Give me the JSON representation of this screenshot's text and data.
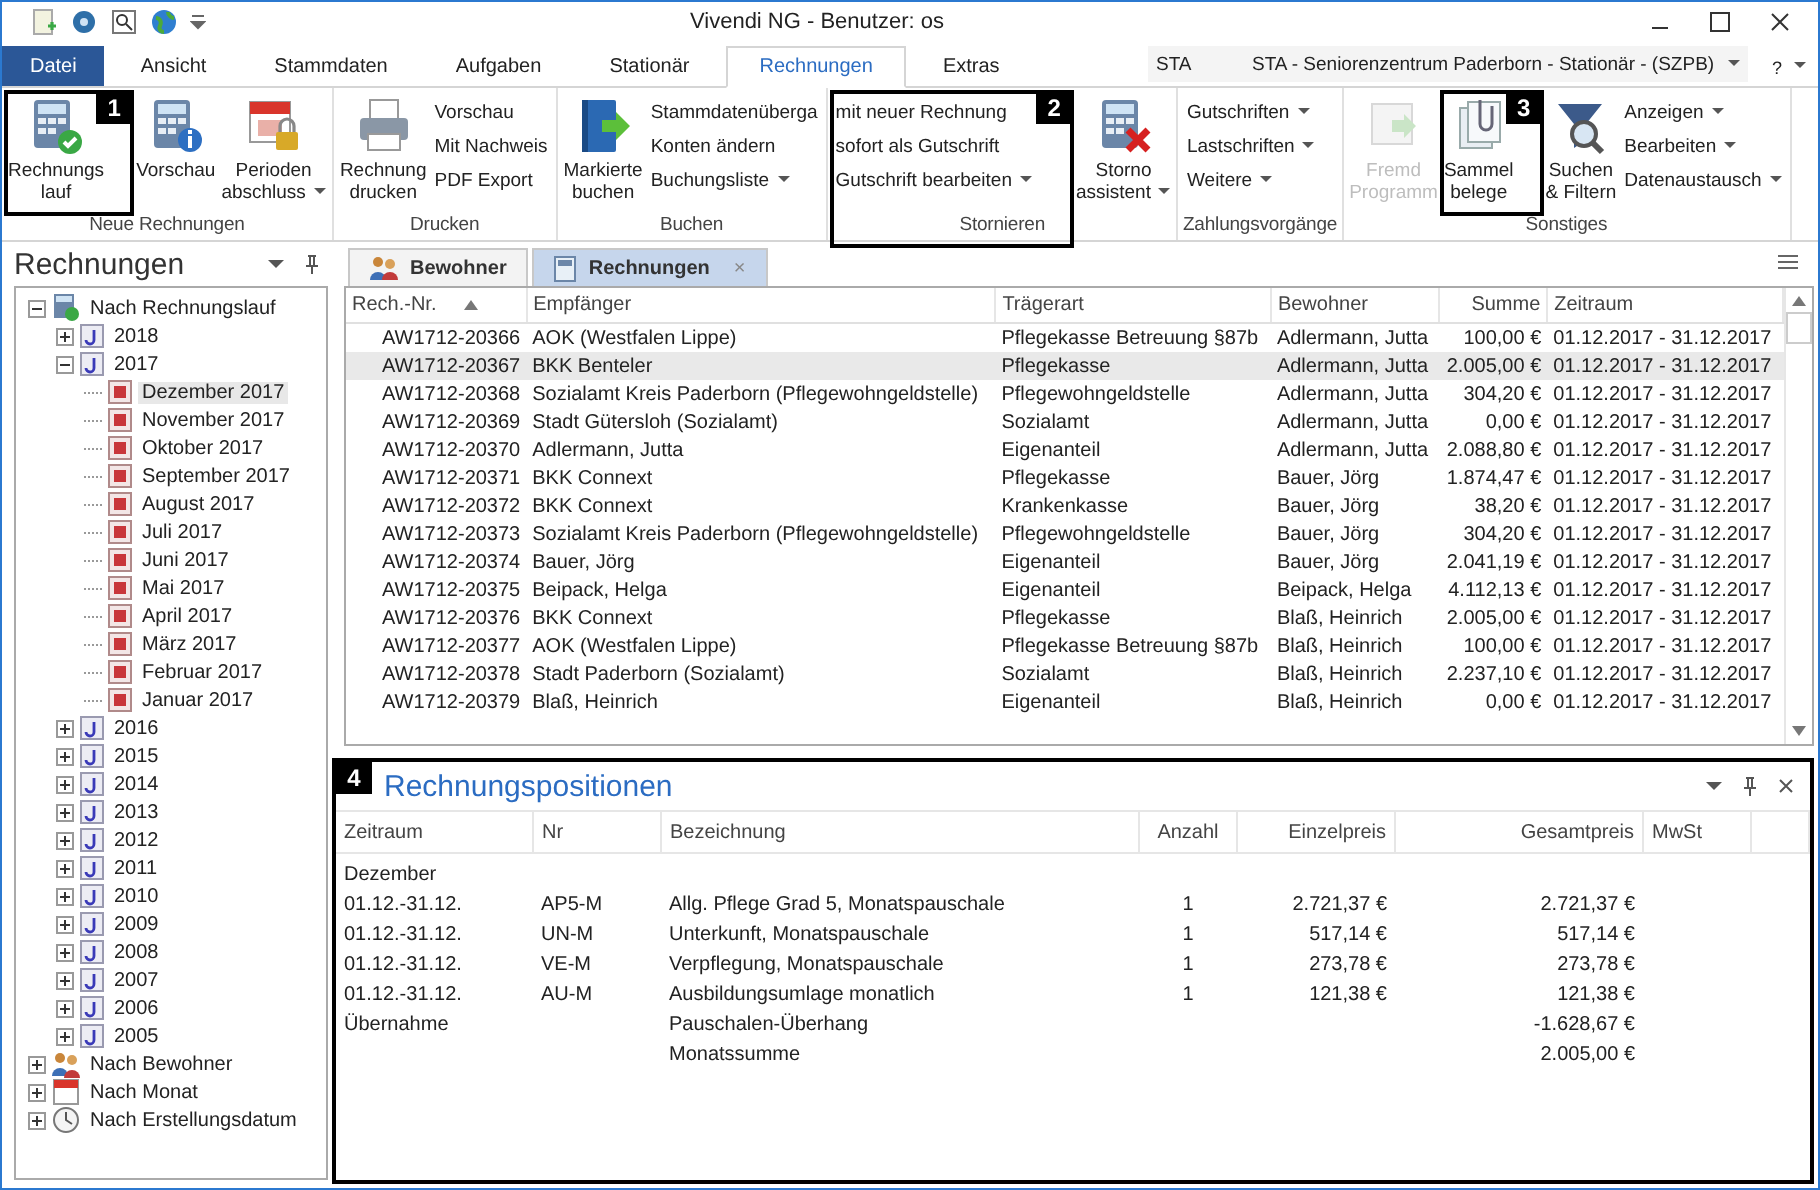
{
  "window": {
    "title": "Vivendi NG - Benutzer: os"
  },
  "ribbon_tabs": [
    {
      "label": "Datei",
      "kind": "app"
    },
    {
      "label": "Ansicht",
      "kind": "tab",
      "selected": false
    },
    {
      "label": "Stammdaten",
      "kind": "tab",
      "selected": false
    },
    {
      "label": "Aufgaben",
      "kind": "tab",
      "selected": false
    },
    {
      "label": "Stationär",
      "kind": "tab",
      "selected": false
    },
    {
      "label": "Rechnungen",
      "kind": "tab",
      "selected": true
    },
    {
      "label": "Extras",
      "kind": "tab",
      "selected": false
    }
  ],
  "station": {
    "code": "STA",
    "name": "STA - Seniorenzentrum Paderborn - Stationär - (SZPB)"
  },
  "help": "?",
  "ribbon_groups": [
    {
      "label": "Neue Rechnungen",
      "items": [
        {
          "kind": "large",
          "lines": [
            "Rechnungs",
            "lauf"
          ],
          "callout": "1"
        },
        {
          "kind": "large",
          "lines": [
            "Vorschau"
          ]
        },
        {
          "kind": "large",
          "lines": [
            "Perioden",
            "abschluss"
          ],
          "dropdown": true
        }
      ]
    },
    {
      "label": "Drucken",
      "items": [
        {
          "kind": "large",
          "lines": [
            "Rechnung",
            "drucken"
          ]
        },
        {
          "kind": "stack",
          "entries": [
            {
              "label": "Vorschau"
            },
            {
              "label": "Mit Nachweis"
            },
            {
              "label": "PDF Export"
            }
          ]
        }
      ]
    },
    {
      "label": "Buchen",
      "items": [
        {
          "kind": "large",
          "lines": [
            "Markierte",
            "buchen"
          ]
        },
        {
          "kind": "stack",
          "entries": [
            {
              "label": "Stammdatenüberga"
            },
            {
              "label": "Konten ändern"
            },
            {
              "label": "Buchungsliste",
              "dropdown": true
            }
          ]
        }
      ]
    },
    {
      "label": "Stornieren",
      "items": [
        {
          "kind": "stack",
          "callout": "2",
          "entries": [
            {
              "label": "mit neuer Rechnung"
            },
            {
              "label": "sofort als Gutschrift"
            },
            {
              "label": "Gutschrift bearbeiten",
              "dropdown": true
            }
          ]
        },
        {
          "kind": "large",
          "lines": [
            "Storno",
            "assistent"
          ],
          "dropdown": true
        }
      ]
    },
    {
      "label": "Zahlungsvorgänge",
      "items": [
        {
          "kind": "stack",
          "entries": [
            {
              "label": "Gutschriften",
              "dropdown": true
            },
            {
              "label": "Lastschriften",
              "dropdown": true
            },
            {
              "label": "Weitere",
              "dropdown": true
            }
          ]
        }
      ]
    },
    {
      "label": "Sonstiges",
      "items": [
        {
          "kind": "large",
          "lines": [
            "Fremd",
            "Programm"
          ],
          "disabled": true
        },
        {
          "kind": "large",
          "lines": [
            "Sammel",
            "belege"
          ],
          "callout": "3"
        },
        {
          "kind": "large",
          "lines": [
            "Suchen",
            "& Filtern"
          ]
        },
        {
          "kind": "stack",
          "entries": [
            {
              "label": "Anzeigen",
              "dropdown": true
            },
            {
              "label": "Bearbeiten",
              "dropdown": true
            },
            {
              "label": "Datenaustausch",
              "dropdown": true
            }
          ]
        }
      ]
    }
  ],
  "side_panel": {
    "title": "Rechnungen",
    "tree": [
      {
        "label": "Nach Rechnungslauf",
        "kind": "run",
        "expanded": true,
        "selected": false,
        "children": [
          {
            "label": "2018",
            "kind": "year",
            "expanded": false,
            "selected": false
          },
          {
            "label": "2017",
            "kind": "year",
            "expanded": true,
            "selected": false,
            "children": [
              {
                "label": "Dezember 2017",
                "kind": "month",
                "selected": true
              },
              {
                "label": "November 2017",
                "kind": "month",
                "selected": false
              },
              {
                "label": "Oktober 2017",
                "kind": "month",
                "selected": false
              },
              {
                "label": "September 2017",
                "kind": "month",
                "selected": false
              },
              {
                "label": "August 2017",
                "kind": "month",
                "selected": false
              },
              {
                "label": "Juli 2017",
                "kind": "month",
                "selected": false
              },
              {
                "label": "Juni 2017",
                "kind": "month",
                "selected": false
              },
              {
                "label": "Mai 2017",
                "kind": "month",
                "selected": false
              },
              {
                "label": "April 2017",
                "kind": "month",
                "selected": false
              },
              {
                "label": "März 2017",
                "kind": "month",
                "selected": false
              },
              {
                "label": "Februar 2017",
                "kind": "month",
                "selected": false
              },
              {
                "label": "Januar 2017",
                "kind": "month",
                "selected": false
              }
            ]
          },
          {
            "label": "2016",
            "kind": "year",
            "expanded": false,
            "selected": false
          },
          {
            "label": "2015",
            "kind": "year",
            "expanded": false,
            "selected": false
          },
          {
            "label": "2014",
            "kind": "year",
            "expanded": false,
            "selected": false
          },
          {
            "label": "2013",
            "kind": "year",
            "expanded": false,
            "selected": false
          },
          {
            "label": "2012",
            "kind": "year",
            "expanded": false,
            "selected": false
          },
          {
            "label": "2011",
            "kind": "year",
            "expanded": false,
            "selected": false
          },
          {
            "label": "2010",
            "kind": "year",
            "expanded": false,
            "selected": false
          },
          {
            "label": "2009",
            "kind": "year",
            "expanded": false,
            "selected": false
          },
          {
            "label": "2008",
            "kind": "year",
            "expanded": false,
            "selected": false
          },
          {
            "label": "2007",
            "kind": "year",
            "expanded": false,
            "selected": false
          },
          {
            "label": "2006",
            "kind": "year",
            "expanded": false,
            "selected": false
          },
          {
            "label": "2005",
            "kind": "year",
            "expanded": false,
            "selected": false
          }
        ]
      },
      {
        "label": "Nach Bewohner",
        "kind": "resident",
        "expanded": false,
        "selected": false
      },
      {
        "label": "Nach Monat",
        "kind": "calendar",
        "expanded": false,
        "selected": false
      },
      {
        "label": "Nach Erstellungsdatum",
        "kind": "clock",
        "expanded": false,
        "selected": false
      }
    ]
  },
  "doc_tabs": [
    {
      "label": "Bewohner",
      "kind": "residents",
      "selected": false
    },
    {
      "label": "Rechnungen",
      "kind": "invoices",
      "selected": true,
      "close": "×"
    }
  ],
  "invoices": {
    "columns": [
      {
        "label": "Rech.-Nr.",
        "sorted": true
      },
      {
        "label": "Empfänger",
        "sorted": false
      },
      {
        "label": "Trägerart",
        "sorted": false
      },
      {
        "label": "Bewohner",
        "sorted": false
      },
      {
        "label": "Summe",
        "sorted": false
      },
      {
        "label": "Zeitraum",
        "sorted": false
      }
    ],
    "rows": [
      {
        "selected": false,
        "cells": [
          "AW1712-20366",
          "AOK (Westfalen Lippe)",
          "Pflegekasse Betreuung §87b",
          "Adlermann, Jutta",
          "100,00 €",
          "01.12.2017 - 31.12.2017"
        ]
      },
      {
        "selected": true,
        "cells": [
          "AW1712-20367",
          "BKK Benteler",
          "Pflegekasse",
          "Adlermann, Jutta",
          "2.005,00 €",
          "01.12.2017 - 31.12.2017"
        ]
      },
      {
        "selected": false,
        "cells": [
          "AW1712-20368",
          "Sozialamt Kreis Paderborn (Pflegewohngeldstelle)",
          "Pflegewohngeldstelle",
          "Adlermann, Jutta",
          "304,20 €",
          "01.12.2017 - 31.12.2017"
        ]
      },
      {
        "selected": false,
        "cells": [
          "AW1712-20369",
          "Stadt Gütersloh (Sozialamt)",
          "Sozialamt",
          "Adlermann, Jutta",
          "0,00 €",
          "01.12.2017 - 31.12.2017"
        ]
      },
      {
        "selected": false,
        "cells": [
          "AW1712-20370",
          "Adlermann, Jutta",
          "Eigenanteil",
          "Adlermann, Jutta",
          "2.088,80 €",
          "01.12.2017 - 31.12.2017"
        ]
      },
      {
        "selected": false,
        "cells": [
          "AW1712-20371",
          "BKK Connext",
          "Pflegekasse",
          "Bauer, Jörg",
          "1.874,47 €",
          "01.12.2017 - 31.12.2017"
        ]
      },
      {
        "selected": false,
        "cells": [
          "AW1712-20372",
          "BKK Connext",
          "Krankenkasse",
          "Bauer, Jörg",
          "38,20 €",
          "01.12.2017 - 31.12.2017"
        ]
      },
      {
        "selected": false,
        "cells": [
          "AW1712-20373",
          "Sozialamt Kreis Paderborn (Pflegewohngeldstelle)",
          "Pflegewohngeldstelle",
          "Bauer, Jörg",
          "304,20 €",
          "01.12.2017 - 31.12.2017"
        ]
      },
      {
        "selected": false,
        "cells": [
          "AW1712-20374",
          "Bauer, Jörg",
          "Eigenanteil",
          "Bauer, Jörg",
          "2.041,19 €",
          "01.12.2017 - 31.12.2017"
        ]
      },
      {
        "selected": false,
        "cells": [
          "AW1712-20375",
          "Beipack, Helga",
          "Eigenanteil",
          "Beipack, Helga",
          "4.112,13 €",
          "01.12.2017 - 31.12.2017"
        ]
      },
      {
        "selected": false,
        "cells": [
          "AW1712-20376",
          "BKK Connext",
          "Pflegekasse",
          "Blaß, Heinrich",
          "2.005,00 €",
          "01.12.2017 - 31.12.2017"
        ]
      },
      {
        "selected": false,
        "cells": [
          "AW1712-20377",
          "AOK (Westfalen Lippe)",
          "Pflegekasse Betreuung §87b",
          "Blaß, Heinrich",
          "100,00 €",
          "01.12.2017 - 31.12.2017"
        ]
      },
      {
        "selected": false,
        "cells": [
          "AW1712-20378",
          "Stadt Paderborn (Sozialamt)",
          "Sozialamt",
          "Blaß, Heinrich",
          "2.237,10 €",
          "01.12.2017 - 31.12.2017"
        ]
      },
      {
        "selected": false,
        "cells": [
          "AW1712-20379",
          "Blaß, Heinrich",
          "Eigenanteil",
          "Blaß, Heinrich",
          "0,00 €",
          "01.12.2017 - 31.12.2017"
        ]
      }
    ]
  },
  "positions": {
    "title": "Rechnungspositionen",
    "callout": "4",
    "columns": [
      "Zeitraum",
      "Nr",
      "Bezeichnung",
      "Anzahl",
      "Einzelpreis",
      "Gesamtpreis",
      "MwSt"
    ],
    "rows": [
      {
        "kind": "group",
        "label": "Dezember"
      },
      {
        "kind": "line",
        "zeitraum": "01.12.-31.12.",
        "nr": "AP5-M",
        "bezeichnung": "Allg. Pflege Grad 5, Monatspauschale",
        "anzahl": "1",
        "einzelpreis": "2.721,37 €",
        "gesamtpreis": "2.721,37 €"
      },
      {
        "kind": "line",
        "zeitraum": "01.12.-31.12.",
        "nr": "UN-M",
        "bezeichnung": "Unterkunft, Monatspauschale",
        "anzahl": "1",
        "einzelpreis": "517,14 €",
        "gesamtpreis": "517,14 €"
      },
      {
        "kind": "line",
        "zeitraum": "01.12.-31.12.",
        "nr": "VE-M",
        "bezeichnung": "Verpflegung, Monatspauschale",
        "anzahl": "1",
        "einzelpreis": "273,78 €",
        "gesamtpreis": "273,78 €"
      },
      {
        "kind": "line",
        "zeitraum": "01.12.-31.12.",
        "nr": "AU-M",
        "bezeichnung": "Ausbildungsumlage monatlich",
        "anzahl": "1",
        "einzelpreis": "121,38 €",
        "gesamtpreis": "121,38 €"
      },
      {
        "kind": "line",
        "zeitraum": "Übernahme",
        "bezeichnung": "Pauschalen-Überhang",
        "gesamtpreis": "-1.628,67 €"
      },
      {
        "kind": "line",
        "bezeichnung": "Monatssumme",
        "gesamtpreis": "2.005,00 €"
      }
    ]
  }
}
